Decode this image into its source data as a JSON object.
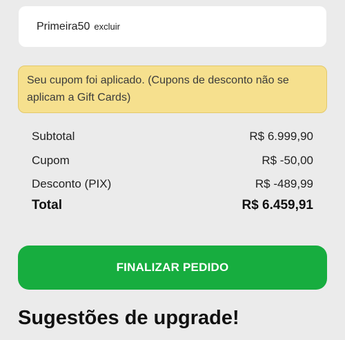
{
  "coupon": {
    "code": "Primeira50",
    "remove_label": "excluir"
  },
  "notice": {
    "text": "Seu cupom foi aplicado. (Cupons de desconto não se aplicam a Gift Cards)"
  },
  "summary": {
    "subtotal_label": "Subtotal",
    "subtotal_value": "R$ 6.999,90",
    "coupon_label": "Cupom",
    "coupon_value": "R$ -50,00",
    "discount_label": "Desconto (PIX)",
    "discount_value": "R$ -489,99",
    "total_label": "Total",
    "total_value": "R$ 6.459,91"
  },
  "checkout": {
    "button_label": "FINALIZAR PEDIDO"
  },
  "upgrade": {
    "title": "Sugestões de upgrade!"
  },
  "colors": {
    "background": "#ebebeb",
    "notice_background": "#f6e08e",
    "button_green": "#17ad3f"
  }
}
